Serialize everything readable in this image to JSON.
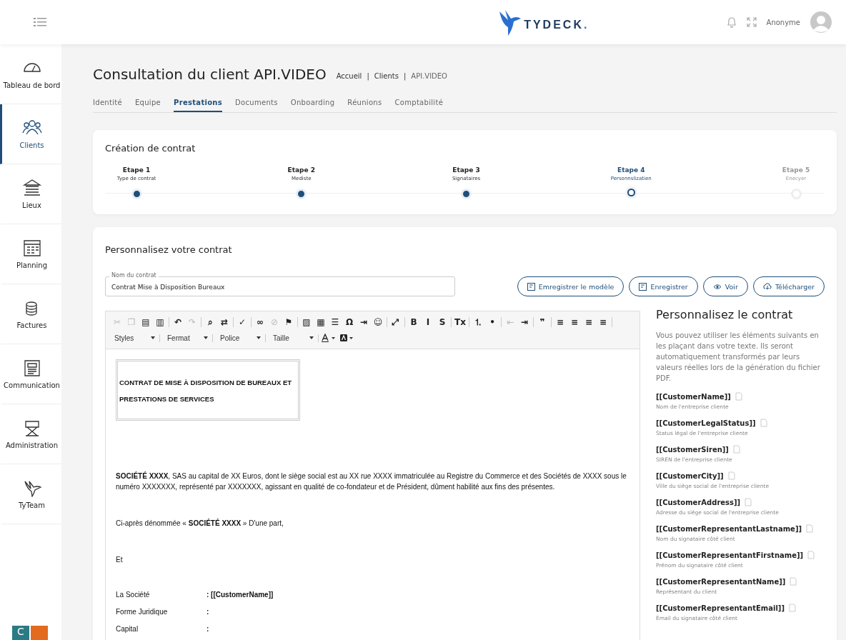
{
  "header": {
    "logo": "TYDECK",
    "logo_dot": ".",
    "user": "Anonyme"
  },
  "sidebar": {
    "items": [
      {
        "label": "Tableau de bord",
        "selected": false
      },
      {
        "label": "Clients",
        "selected": true
      },
      {
        "label": "Lieux",
        "selected": false
      },
      {
        "label": "Planning",
        "selected": false
      },
      {
        "label": "Factures",
        "selected": false
      },
      {
        "label": "Communication",
        "selected": false
      },
      {
        "label": "Administration",
        "selected": false
      },
      {
        "label": "TyTeam",
        "selected": false
      }
    ],
    "badge": "C"
  },
  "page": {
    "title": "Consultation du client API.VIDEO",
    "breadcrumb": [
      {
        "label": "Accueil",
        "separator": "|"
      },
      {
        "label": "Clients",
        "separator": "|"
      },
      {
        "label": "API.VIDEO"
      }
    ]
  },
  "tabs": [
    {
      "label": "Identité",
      "selected": false
    },
    {
      "label": "Equipe",
      "selected": false
    },
    {
      "label": "Prestations",
      "selected": true
    },
    {
      "label": "Documents",
      "selected": false
    },
    {
      "label": "Onboarding",
      "selected": false
    },
    {
      "label": "Réunions",
      "selected": false
    },
    {
      "label": "Comptabilité",
      "selected": false
    }
  ],
  "stepper": {
    "title": "Création de contrat",
    "steps": [
      {
        "title": "Etape 1",
        "label": "Type de contrat",
        "completed": true,
        "active": false
      },
      {
        "title": "Etape 2",
        "label": "Mediste",
        "completed": true,
        "active": false
      },
      {
        "title": "Etape 3",
        "label": "Signataires",
        "completed": true,
        "active": false
      },
      {
        "title": "Etape 4",
        "label": "Personnslizatien",
        "completed": false,
        "active": true
      },
      {
        "title": "Etape 5",
        "label": "Enecyer",
        "completed": false,
        "active": false
      }
    ]
  },
  "editor_card": {
    "title": "Personnalisez votre contrat",
    "name_field": {
      "label": "Nom du contrat",
      "value": "Contrat Mise à Disposition Bureaux"
    },
    "buttons": [
      "Emregistrer le modèle",
      "Enregistrer",
      "Voir",
      "Télécharger"
    ],
    "toolbar": [
      [
        {
          "glyph": "✂",
          "disabled": true
        },
        {
          "glyph": "❐",
          "disabled": true
        },
        {
          "glyph": "▤",
          "disabled": false
        },
        {
          "glyph": "▥",
          "disabled": false
        }
      ],
      [
        {
          "glyph": "↶",
          "disabled": false
        },
        {
          "glyph": "↷",
          "disabled": true
        }
      ],
      [
        {
          "glyph": "⌕",
          "disabled": false
        },
        {
          "glyph": "⇄",
          "disabled": false
        }
      ],
      [
        {
          "glyph": "✓",
          "disabled": false
        }
      ],
      [
        {
          "glyph": "∞",
          "disabled": false
        },
        {
          "glyph": "⊘",
          "disabled": true
        },
        {
          "glyph": "⚑",
          "disabled": false
        }
      ],
      [
        {
          "glyph": "▨",
          "disabled": false
        },
        {
          "glyph": "▦",
          "disabled": false
        },
        {
          "glyph": "☰",
          "disabled": false
        },
        {
          "glyph": "Ω",
          "disabled": false
        },
        {
          "glyph": "⇥",
          "disabled": false
        },
        {
          "glyph": "☺",
          "disabled": false
        }
      ],
      [
        {
          "glyph": "⤢",
          "disabled": false
        }
      ],
      [
        {
          "glyph": "B",
          "disabled": false
        },
        {
          "glyph": "I",
          "disabled": false
        },
        {
          "glyph": "S",
          "disabled": false
        }
      ],
      [
        {
          "glyph": "Tx",
          "disabled": false
        }
      ],
      [
        {
          "glyph": "⒈",
          "disabled": false
        },
        {
          "glyph": "•",
          "disabled": false
        }
      ],
      [
        {
          "glyph": "⇤",
          "disabled": true
        },
        {
          "glyph": "⇥",
          "disabled": false
        }
      ],
      [
        {
          "glyph": "❞",
          "disabled": false
        }
      ],
      [
        {
          "glyph": "≡",
          "disabled": false
        },
        {
          "glyph": "≡",
          "disabled": false
        },
        {
          "glyph": "≡",
          "disabled": false
        },
        {
          "glyph": "≡",
          "disabled": false
        }
      ]
    ],
    "dropdowns": [
      "Styles",
      "Fermat",
      "Police",
      "Taille"
    ],
    "document": {
      "title_lines": [
        "CONTRAT DE MISE À DISPOSITION DE BUREAUX ET",
        "PRESTATIONS DE SERVICES"
      ],
      "paragraphs": [
        "**SOCIÉTÉ XXXX**, SAS au capital de XX Euros, dont le siège social est au XX rue XXXX immatriculée au Registre du Commerce et des Sociétés de XXXX sous le numéro XXXXXXX, représenté par XXXXXXX, agissant en qualité de co-fondateur et de Président, dûment habilité aux fins des présentes.",
        "Ci-après dénommée « **SOCIÉTÉ XXXX** » D'une part,",
        "Et"
      ],
      "fields": [
        {
          "label": "La Société",
          "value": ": [[CustomerName]]"
        },
        {
          "label": "Forme Juridique",
          "value": ":"
        },
        {
          "label": "Capital",
          "value": ":"
        }
      ]
    },
    "panel": {
      "title": "Personnalisez le contrat",
      "intro": "Vous pouvez utiliser les éléments suivants en les plaçant dans votre texte. Ils seront automatiquement transformés par leurs valeurs réelles lors de la génération du fichier PDF.",
      "variables": [
        {
          "name": "[[CustomerName]]",
          "description": "Nom de l'entreprise cliente"
        },
        {
          "name": "[[CustomerLegalStatus]]",
          "description": "Status légal de l'entreprise cliente"
        },
        {
          "name": "[[CustomerSiren]]",
          "description": "SIREN de l'entreprise cliente"
        },
        {
          "name": "[[CustomerCity]]",
          "description": "Ville du siège social de l'entreprise cliente"
        },
        {
          "name": "[[CustomerAddress]]",
          "description": "Adresse du siège social de l'entreprise cliente"
        },
        {
          "name": "[[CustomerRepresentantLastname]]",
          "description": "Nom du signataire côté client"
        },
        {
          "name": "[[CustomerRepresentantFirstname]]",
          "description": "Prénom du signataire côté client"
        },
        {
          "name": "[[CustomerRepresentantName]]",
          "description": "Représentant du client"
        },
        {
          "name": "[[CustomerRepresentantEmail]]",
          "description": "Email du signataire côté client"
        }
      ]
    }
  }
}
